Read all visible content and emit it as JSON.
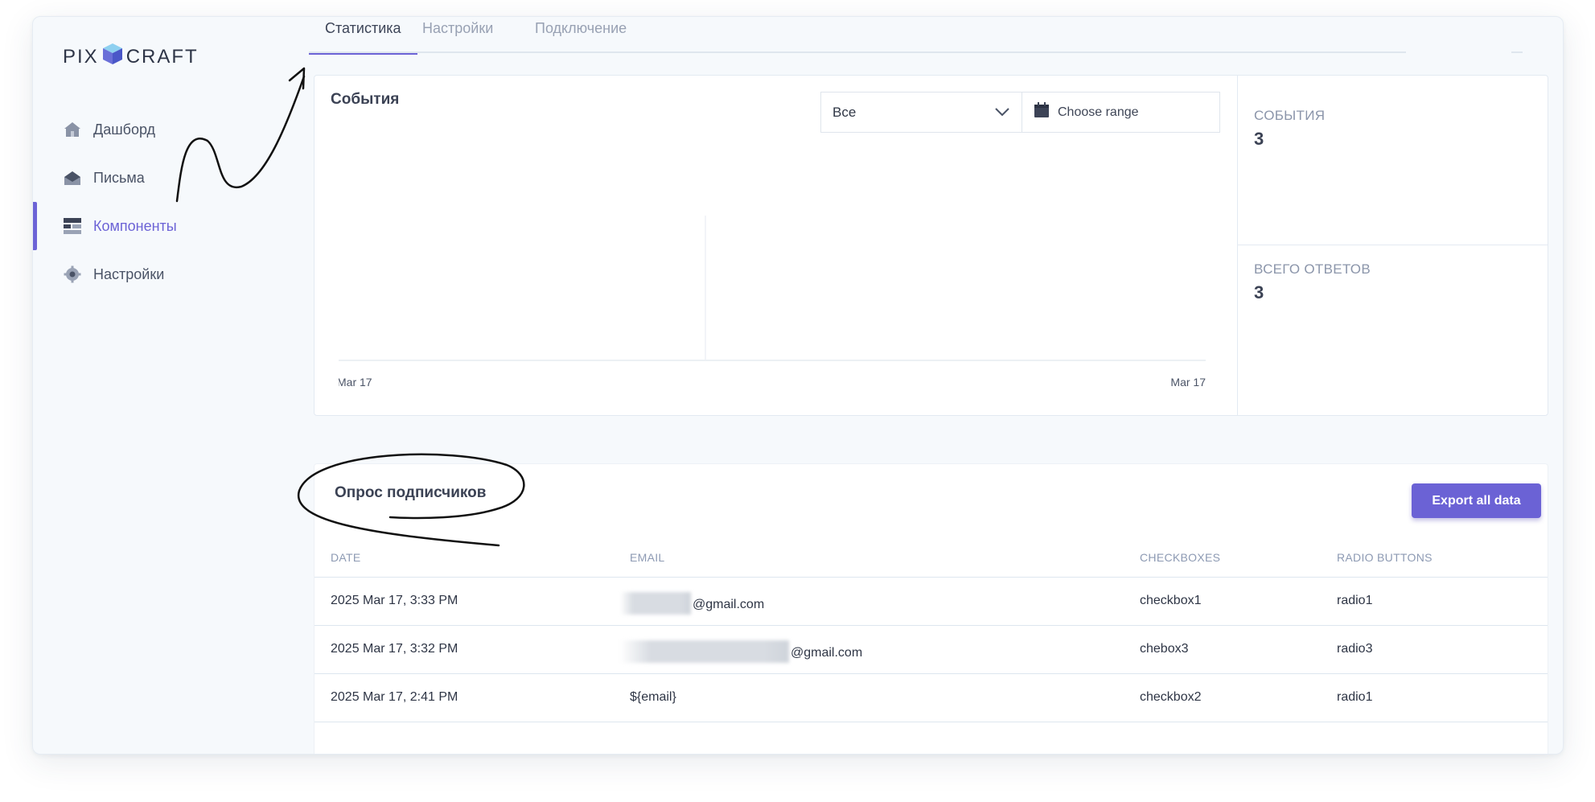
{
  "brand": {
    "left": "PIX",
    "right": "CRAFT"
  },
  "sidebar": {
    "items": [
      {
        "label": "Дашборд",
        "icon": "home-icon"
      },
      {
        "label": "Письма",
        "icon": "mail-icon"
      },
      {
        "label": "Компоненты",
        "icon": "components-icon",
        "active": true
      },
      {
        "label": "Настройки",
        "icon": "gear-icon"
      }
    ]
  },
  "tabs": [
    {
      "label": "Статистика",
      "active": true
    },
    {
      "label": "Настройки"
    },
    {
      "label": "Подключение"
    }
  ],
  "events": {
    "title": "События",
    "filter_value": "Все",
    "range_placeholder": "Choose range",
    "stats": [
      {
        "label": "СОБЫТИЯ",
        "value": "3"
      },
      {
        "label": "ВСЕГО ОТВЕТОВ",
        "value": "3"
      }
    ]
  },
  "chart_data": {
    "type": "line",
    "x": [
      "Mar 17",
      "Mar 17"
    ],
    "series": [],
    "grid": false
  },
  "survey": {
    "title": "Опрос подписчиков",
    "export_label": "Export all data",
    "columns": [
      "DATE",
      "EMAIL",
      "CHECKBOXES",
      "RADIO BUTTONS"
    ],
    "rows": [
      {
        "date": "2025 Mar 17, 3:33 PM",
        "email": "@gmail.com",
        "checkboxes": "checkbox1",
        "radio": "radio1",
        "redacted": "short"
      },
      {
        "date": "2025 Mar 17, 3:32 PM",
        "email": "@gmail.com",
        "checkboxes": "chebox3",
        "radio": "radio3",
        "redacted": "long"
      },
      {
        "date": "2025 Mar 17, 2:41 PM",
        "email": "${email}",
        "checkboxes": "checkbox2",
        "radio": "radio1",
        "redacted": "none"
      }
    ]
  },
  "colors": {
    "accent": "#6c63d6",
    "text": "#3b4254",
    "muted": "#8d9ab3"
  }
}
